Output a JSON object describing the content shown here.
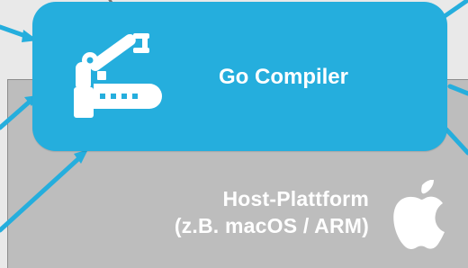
{
  "compiler": {
    "label": "Go Compiler",
    "icon": "robot-arm-icon"
  },
  "host_platform": {
    "line1": "Host-Plattform",
    "line2": "(z.B. macOS / ARM)",
    "icon": "apple-icon"
  },
  "colors": {
    "compiler_fill": "#25aedd",
    "arrow": "#25aedd",
    "platform_fill": "#bdbdbd",
    "background": "#e9e9e9",
    "text": "#ffffff"
  }
}
